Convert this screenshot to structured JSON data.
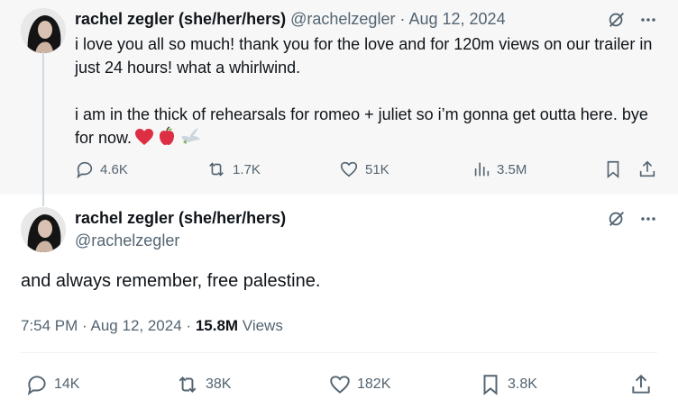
{
  "parent_tweet": {
    "author_name": "rachel zegler (she/her/hers)",
    "handle": "@rachelzegler",
    "separator": "·",
    "date": "Aug 12, 2024",
    "text_line1": "i love you all so much! thank you for the love and for 120m views on our trailer in just 24 hours! what a whirlwind.",
    "text_line2": "i am in the thick of rehearsals for romeo + juliet so i’m gonna get outta here. bye for now.",
    "emojis": [
      "heart",
      "apple",
      "dove"
    ],
    "stats": {
      "replies": "4.6K",
      "reposts": "1.7K",
      "likes": "51K",
      "views": "3.5M"
    }
  },
  "main_tweet": {
    "author_name": "rachel zegler (she/her/hers)",
    "handle": "@rachelzegler",
    "text": "and always remember, free palestine.",
    "time": "7:54 PM",
    "separator": "·",
    "date": "Aug 12, 2024",
    "separator2": "·",
    "views_count": "15.8M",
    "views_label": "Views",
    "stats": {
      "replies": "14K",
      "reposts": "38K",
      "likes": "182K",
      "bookmarks": "3.8K"
    }
  },
  "colors": {
    "text_primary": "#0f1419",
    "text_secondary": "#536471",
    "parent_background": "#f7f7f7",
    "thread_line": "#cfd9de",
    "heart_emoji": "#dd2e44"
  },
  "icons": {
    "grok": "grok-icon",
    "more": "more-icon",
    "reply": "reply-icon",
    "repost": "repost-icon",
    "like": "like-icon",
    "views": "views-icon",
    "bookmark": "bookmark-icon",
    "share": "share-icon"
  }
}
